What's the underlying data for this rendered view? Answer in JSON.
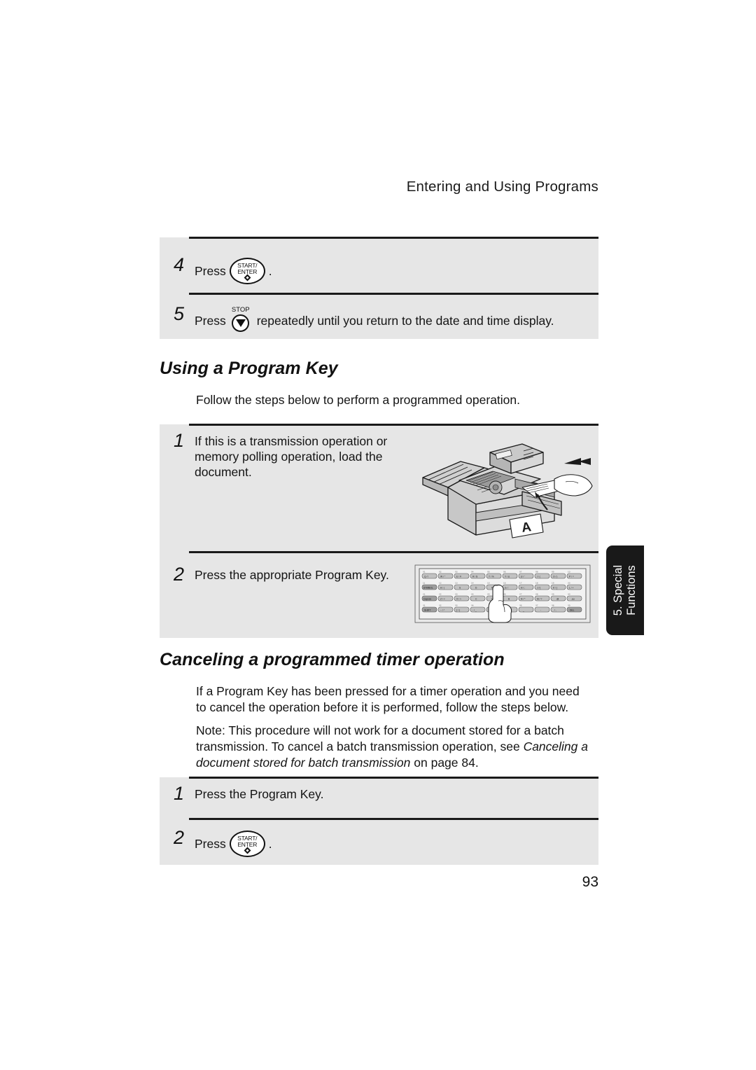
{
  "header": {
    "running_head": "Entering and Using Programs"
  },
  "panel_top": {
    "steps": [
      {
        "num": "4",
        "pre": "Press",
        "key": "start-enter",
        "post": "."
      },
      {
        "num": "5",
        "pre": "Press",
        "key": "stop",
        "post": "repeatedly until you return to the date and time display."
      }
    ]
  },
  "section_using": {
    "heading": "Using a Program Key",
    "intro": "Follow the steps below to perform a programmed operation.",
    "steps": [
      {
        "num": "1",
        "text": "If this is a transmission operation or memory polling operation, load the document."
      },
      {
        "num": "2",
        "text": "Press the appropriate Program Key."
      }
    ]
  },
  "section_cancel": {
    "heading": "Canceling a programmed timer operation",
    "paragraph": "If a Program Key has been pressed for a timer operation and you need to cancel the operation before it is performed, follow the steps below.",
    "note_prefix": "Note:  This procedure will not work for a document stored for a batch transmission. To cancel a batch transmission operation, see ",
    "note_italic": "Canceling a document stored for batch transmission",
    "note_suffix": " on page 84.",
    "steps": [
      {
        "num": "1",
        "pre": "Press the Program Key.",
        "key": "",
        "post": ""
      },
      {
        "num": "2",
        "pre": "Press",
        "key": "start-enter",
        "post": "."
      }
    ]
  },
  "keys": {
    "start_enter": {
      "line1": "START/",
      "line2": "ENTER",
      "glyph": "power-diamond-icon"
    },
    "stop": {
      "caption": "STOP",
      "glyph": "stop-triangle-icon"
    }
  },
  "side_tab": {
    "line1": "5. Special",
    "line2": "Functions"
  },
  "footer": {
    "page_number": "93"
  },
  "illustrations": {
    "fax_machine": {
      "name": "fax-machine-loading-document",
      "sheet_label": "A"
    },
    "keyboard": {
      "name": "program-key-keyboard",
      "row1": [
        "Q / !",
        "W / \"",
        "E / #",
        "R / $",
        "T / %",
        "Y / &",
        "U / '",
        "I / (",
        "O / )",
        "P / ="
      ],
      "row1_nums": [
        "01",
        "02",
        "03",
        "04",
        "05",
        "06",
        "07",
        "08",
        "09",
        "10"
      ],
      "row2": [
        "SYMBOL",
        "A / |",
        "S",
        "D",
        "F",
        "G / :",
        "H / ;",
        "J / [",
        "K / ]",
        "L / +"
      ],
      "row2_nums": [
        "11",
        "12",
        "13",
        "14",
        "15",
        "16",
        "17",
        "18",
        "19",
        "20"
      ],
      "row3": [
        "CapsLock",
        "Z / <",
        "X / >",
        "C",
        "V",
        "B",
        "N / *",
        "M / ?",
        "@",
        ".au"
      ],
      "row3_nums": [
        "21",
        "22",
        "23",
        "24",
        "25",
        "26",
        "27",
        "28",
        "29",
        "30"
      ],
      "row4": [
        "SHIFT",
        "~ / ^",
        "{ / }",
        "- / _",
        "",
        "_",
        "-",
        ". / ,",
        "DEL"
      ],
      "row4_nums": [
        "31",
        "32",
        "33",
        "34",
        "",
        "",
        "36",
        "37",
        "38",
        "39"
      ]
    }
  },
  "colors": {
    "panel_gray": "#e6e6e6",
    "rule_black": "#1a1a1a",
    "tab_black": "#191919",
    "text": "#141414"
  }
}
